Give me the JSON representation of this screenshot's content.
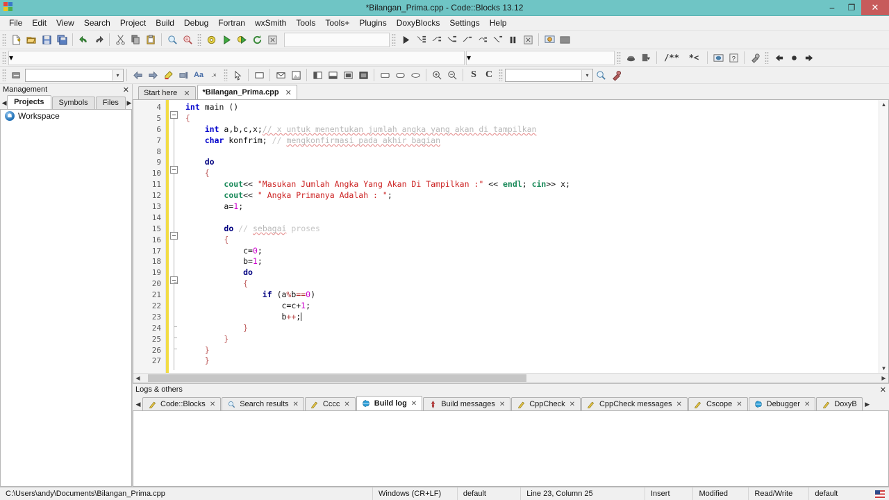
{
  "window": {
    "title": "*Bilangan_Prima.cpp - Code::Blocks 13.12",
    "minimize": "–",
    "maximize": "❐",
    "close": "✕"
  },
  "menubar": {
    "items": [
      {
        "label": "File"
      },
      {
        "label": "Edit"
      },
      {
        "label": "View"
      },
      {
        "label": "Search"
      },
      {
        "label": "Project"
      },
      {
        "label": "Build"
      },
      {
        "label": "Debug"
      },
      {
        "label": "Fortran"
      },
      {
        "label": "wxSmith"
      },
      {
        "label": "Tools"
      },
      {
        "label": "Tools+"
      },
      {
        "label": "Plugins"
      },
      {
        "label": "DoxyBlocks"
      },
      {
        "label": "Settings"
      },
      {
        "label": "Help"
      }
    ]
  },
  "toolbars": {
    "main": {
      "icons": [
        "new-file-icon",
        "open-file-icon",
        "save-icon",
        "save-all-icon",
        "undo-icon",
        "redo-icon",
        "cut-icon",
        "copy-icon",
        "paste-icon",
        "find-icon",
        "replace-icon"
      ],
      "build_icons": [
        "build-icon",
        "run-icon",
        "build-and-run-icon",
        "rebuild-icon",
        "abort-build-icon"
      ],
      "target_value": "",
      "target_placeholder": ""
    },
    "debug": {
      "icons": [
        "debug-continue-icon",
        "step-into-icon",
        "next-line-icon",
        "step-out-icon",
        "step-instruction-icon",
        "next-instruction-icon",
        "run-to-cursor-icon",
        "pause-icon",
        "stop-debugger-icon",
        "debug-windows-icon",
        "various-info-icon"
      ]
    },
    "compiler_row": {
      "combo_value": ""
    },
    "doxyblocks": {
      "icons": [
        "doxywizard-icon",
        "extract-docs-icon",
        "comment-block-icon",
        "comment-line-icon",
        "run-html-icon",
        "run-help-icon",
        "doxyblocks-settings-icon"
      ],
      "nav_icons": [
        "back-icon",
        "bookmark-icon",
        "forward-icon"
      ]
    },
    "wxsmith": {
      "search_value": "",
      "icons": [
        "goto-declaration-icon",
        "back-arrow-icon",
        "forward-arrow-icon",
        "highlight-icon",
        "align-icon",
        "font-icon",
        "small-x-icon",
        "pointer-icon",
        "panel-icon",
        "envelope-icon",
        "image-icon"
      ],
      "layout_icons": [
        "layout-left-icon",
        "layout-bottom-icon",
        "layout-center-icon",
        "layout-full-icon",
        "box-icon",
        "rounded-box-icon",
        "ellipse-box-icon"
      ],
      "zoom_icons": [
        "zoom-in-icon",
        "zoom-out-icon"
      ],
      "letters": [
        "S",
        "C"
      ],
      "find_value": "",
      "find_icons": [
        "search-symbol-icon",
        "wrench-icon"
      ]
    }
  },
  "management": {
    "title": "Management",
    "close": "✕",
    "nav_prev": "◀",
    "nav_next": "▶",
    "tabs": [
      {
        "label": "Projects",
        "active": true
      },
      {
        "label": "Symbols",
        "active": false
      },
      {
        "label": "Files",
        "active": false
      }
    ],
    "tree": [
      {
        "label": "Workspace",
        "icon": "workspace-icon"
      }
    ]
  },
  "editor": {
    "tabs": [
      {
        "label": "Start here",
        "active": false,
        "close": "✕"
      },
      {
        "label": "*Bilangan_Prima.cpp",
        "active": true,
        "close": "✕"
      }
    ],
    "first_line_number": 4,
    "line_numbers": [
      4,
      5,
      6,
      7,
      8,
      9,
      10,
      11,
      12,
      13,
      14,
      15,
      16,
      17,
      18,
      19,
      20,
      21,
      22,
      23,
      24,
      25,
      26,
      27
    ],
    "code_lines": [
      {
        "n": 4,
        "text": "int main ()"
      },
      {
        "n": 5,
        "text": "{"
      },
      {
        "n": 6,
        "text": "    int a,b,c,x;// x untuk menentukan jumlah angka yang akan di tampilkan"
      },
      {
        "n": 7,
        "text": "    char konfrim; // mengkonfirmasi pada akhir bagian"
      },
      {
        "n": 8,
        "text": ""
      },
      {
        "n": 9,
        "text": "    do"
      },
      {
        "n": 10,
        "text": "    {"
      },
      {
        "n": 11,
        "text": "        cout<< \"Masukan Jumlah Angka Yang Akan Di Tampilkan :\" << endl; cin>> x;"
      },
      {
        "n": 12,
        "text": "        cout<< \" Angka Primanya Adalah : \";"
      },
      {
        "n": 13,
        "text": "        a=1;"
      },
      {
        "n": 14,
        "text": ""
      },
      {
        "n": 15,
        "text": "        do // sebagai proses"
      },
      {
        "n": 16,
        "text": "        {"
      },
      {
        "n": 17,
        "text": "            c=0;"
      },
      {
        "n": 18,
        "text": "            b=1;"
      },
      {
        "n": 19,
        "text": "            do"
      },
      {
        "n": 20,
        "text": "            {"
      },
      {
        "n": 21,
        "text": "                if (a%b==0)"
      },
      {
        "n": 22,
        "text": "                    c=c+1;"
      },
      {
        "n": 23,
        "text": "                    b++;"
      },
      {
        "n": 24,
        "text": "            }"
      },
      {
        "n": 25,
        "text": "        }"
      },
      {
        "n": 26,
        "text": "    }"
      },
      {
        "n": 27,
        "text": "    }"
      }
    ],
    "comments": {
      "line6": "// x untuk menentukan jumlah angka yang akan di tampilkan",
      "line7": "// mengkonfirmasi pada akhir bagian",
      "line15": "// sebagai proses"
    },
    "strings": {
      "line11": "\"Masukan Jumlah Angka Yang Akan Di Tampilkan :\"",
      "line12": "\" Angka Primanya Adalah : \""
    },
    "scroll_left": "◀",
    "scroll_right": "▶",
    "scroll_up": "▲",
    "scroll_down": "▼"
  },
  "logs": {
    "title": "Logs & others",
    "close": "✕",
    "nav_prev": "◀",
    "nav_next": "▶",
    "tabs": [
      {
        "label": "Code::Blocks",
        "active": false,
        "icon": "pencil-icon",
        "close": "✕"
      },
      {
        "label": "Search results",
        "active": false,
        "icon": "magnifier-icon",
        "close": "✕"
      },
      {
        "label": "Cccc",
        "active": false,
        "icon": "pencil-icon",
        "close": "✕"
      },
      {
        "label": "Build log",
        "active": true,
        "icon": "globe-icon",
        "close": "✕"
      },
      {
        "label": "Build messages",
        "active": false,
        "icon": "pin-icon",
        "close": "✕"
      },
      {
        "label": "CppCheck",
        "active": false,
        "icon": "pencil-icon",
        "close": "✕"
      },
      {
        "label": "CppCheck messages",
        "active": false,
        "icon": "pencil-icon",
        "close": "✕"
      },
      {
        "label": "Cscope",
        "active": false,
        "icon": "pencil-icon",
        "close": "✕"
      },
      {
        "label": "Debugger",
        "active": false,
        "icon": "globe-icon",
        "close": "✕"
      },
      {
        "label": "DoxyB",
        "active": false,
        "icon": "pencil-icon",
        "close": ""
      }
    ]
  },
  "statusbar": {
    "path": "C:\\Users\\andy\\Documents\\Bilangan_Prima.cpp",
    "eol": "Windows (CR+LF)",
    "encoding": "default",
    "position": "Line 23, Column 25",
    "mode": "Insert",
    "modified": "Modified",
    "access": "Read/Write",
    "profile": "default",
    "flag": "us-flag-icon"
  },
  "colors": {
    "titlebar": "#6fc5c5",
    "close_button": "#c75b5b",
    "change_bar": "#f2dc45",
    "click_highlight": "#fbf04a",
    "string": "#cc2222",
    "keyword": "#0000cc",
    "std_function": "#1a8a5a",
    "number": "#cc00cc",
    "comment": "#b9b9b9"
  }
}
